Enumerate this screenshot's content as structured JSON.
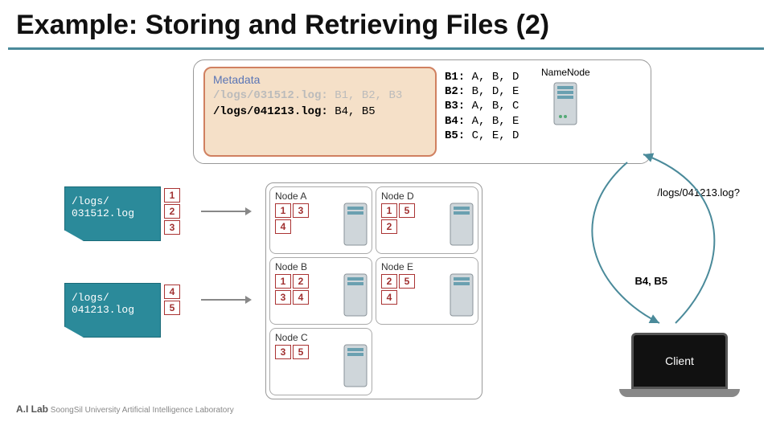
{
  "title": "Example: Storing and Retrieving Files (2)",
  "metadata": {
    "label": "Metadata",
    "line1_path": "/logs/031512.log:",
    "line1_blocks": "B1, B2, B3",
    "line2_path": "/logs/041213.log:",
    "line2_blocks": "B4, B5"
  },
  "blockmap": [
    {
      "id": "B1:",
      "nodes": "A, B, D"
    },
    {
      "id": "B2:",
      "nodes": "B, D, E"
    },
    {
      "id": "B3:",
      "nodes": "A, B, C"
    },
    {
      "id": "B4:",
      "nodes": "A, B, E"
    },
    {
      "id": "B5:",
      "nodes": "C, E, D"
    }
  ],
  "namenode_label": "NameNode",
  "files": {
    "f1": {
      "path_l1": "/logs/",
      "path_l2": "031512.log",
      "blocks": [
        "1",
        "2",
        "3"
      ]
    },
    "f2": {
      "path_l1": "/logs/",
      "path_l2": "041213.log",
      "blocks": [
        "4",
        "5"
      ]
    }
  },
  "nodes": {
    "A": {
      "label": "Node A",
      "blocks": [
        "1",
        "3",
        "4"
      ]
    },
    "D": {
      "label": "Node D",
      "blocks": [
        "1",
        "5",
        "2"
      ]
    },
    "B": {
      "label": "Node B",
      "blocks": [
        "1",
        "2",
        "3",
        "4"
      ]
    },
    "E": {
      "label": "Node E",
      "blocks": [
        "2",
        "5",
        "4"
      ]
    },
    "C": {
      "label": "Node C",
      "blocks": [
        "3",
        "5"
      ]
    }
  },
  "query": "/logs/041213.log?",
  "response": "B4, B5",
  "client_label": "Client",
  "footer": {
    "brand": "A.I Lab",
    "sub": "SoongSil University Artificial Intelligence Laboratory"
  }
}
